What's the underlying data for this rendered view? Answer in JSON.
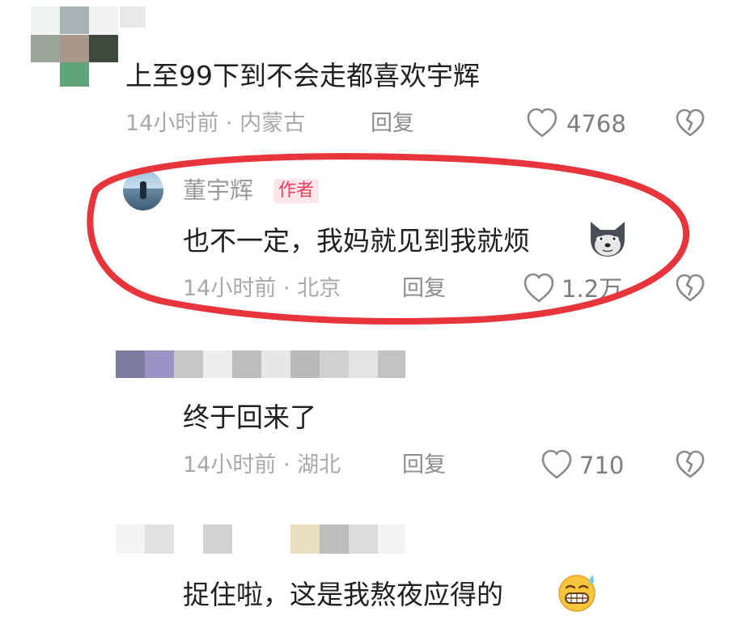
{
  "comments": [
    {
      "text": "上至99下到不会走都喜欢宇辉",
      "meta": "14小时前 · 内蒙古",
      "reply_label": "回复",
      "likes": "4768"
    },
    {
      "author": "董宇辉",
      "author_badge": "作者",
      "text": "也不一定，我妈就见到我就烦",
      "meta": "14小时前 · 北京",
      "reply_label": "回复",
      "likes": "1.2万"
    },
    {
      "text": "终于回来了",
      "meta": "14小时前 · 湖北",
      "reply_label": "回复",
      "likes": "710"
    },
    {
      "text": "捉住啦，这是我熬夜应得的"
    }
  ],
  "colors": {
    "highlight_circle": "#e8343b",
    "author_badge_bg": "#fde6ea",
    "author_badge_text": "#f2405e"
  },
  "icons": [
    "heart-icon",
    "dislike-icon",
    "husky-emoji-icon",
    "grimace-sweat-emoji-icon"
  ]
}
